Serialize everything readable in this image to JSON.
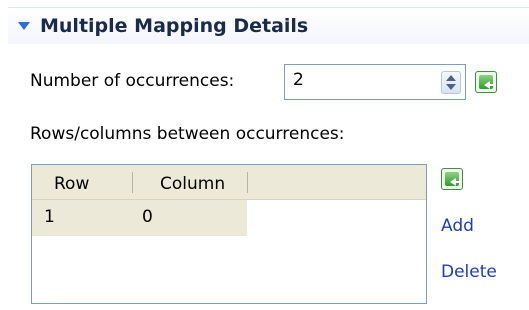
{
  "section": {
    "title": "Multiple Mapping Details"
  },
  "occurrences": {
    "label": "Number of occurrences:",
    "value": "2"
  },
  "rows_between": {
    "label": "Rows/columns between occurrences:"
  },
  "table": {
    "columns": [
      "Row",
      "Column"
    ],
    "rows": [
      [
        "1",
        "0"
      ]
    ]
  },
  "actions": {
    "add_label": "Add",
    "delete_label": "Delete"
  },
  "icons": {
    "twisty": "chevron-down-icon",
    "spinner": "spin-arrows-icon",
    "green_button": "green-arrow-icon"
  },
  "colors": {
    "accent": "#2a6fd6",
    "link": "#1a3dba",
    "header_bg": "#ece9d8"
  }
}
